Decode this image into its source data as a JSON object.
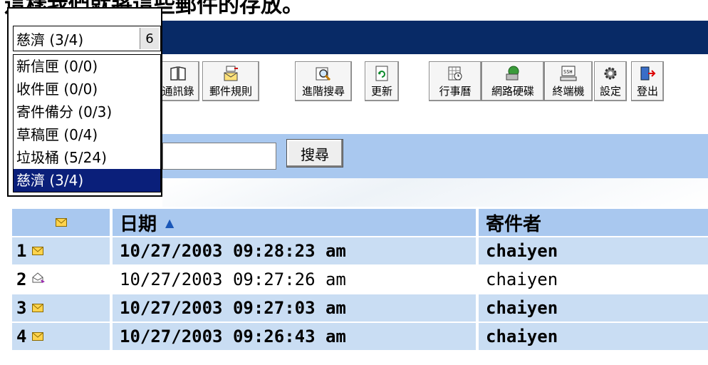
{
  "caption": "這樣我們就將這些郵件的存放。",
  "folder_select": {
    "selected": "慈濟 (3/4)",
    "arrow": "6",
    "options": [
      "新信匣 (0/0)",
      "收件匣 (0/0)",
      "寄件備分 (0/3)",
      "草稿匣 (0/4)",
      "垃圾桶 (5/24)",
      "慈濟 (3/4)"
    ]
  },
  "toolbar": {
    "buttons": [
      {
        "label": "通訊錄",
        "icon": "address-book-icon"
      },
      {
        "label": "郵件規則",
        "icon": "mail-rules-icon"
      },
      {
        "label": "進階搜尋",
        "icon": "advanced-search-icon"
      },
      {
        "label": "更新",
        "icon": "refresh-icon"
      },
      {
        "label": "行事曆",
        "icon": "calendar-icon"
      },
      {
        "label": "網路硬碟",
        "icon": "network-drive-icon"
      },
      {
        "label": "終端機",
        "icon": "terminal-icon"
      },
      {
        "label": "設定",
        "icon": "settings-icon"
      },
      {
        "label": "登出",
        "icon": "logout-icon"
      }
    ]
  },
  "search": {
    "button_label": "搜尋"
  },
  "table": {
    "headers": {
      "date": "日期",
      "sender": "寄件者"
    },
    "rows": [
      {
        "num": "1",
        "date": "10/27/2003 09:28:23 am",
        "sender": "chaiyen",
        "unread": true
      },
      {
        "num": "2",
        "date": "10/27/2003 09:27:26 am",
        "sender": "chaiyen",
        "unread": false
      },
      {
        "num": "3",
        "date": "10/27/2003 09:27:03 am",
        "sender": "chaiyen",
        "unread": true
      },
      {
        "num": "4",
        "date": "10/27/2003 09:26:43 am",
        "sender": "chaiyen",
        "unread": true
      }
    ]
  },
  "colors": {
    "navbar": "#082a66",
    "header": "#a9c8ef",
    "row_alt": "#c9ddf3",
    "selection": "#0a1f7a"
  }
}
